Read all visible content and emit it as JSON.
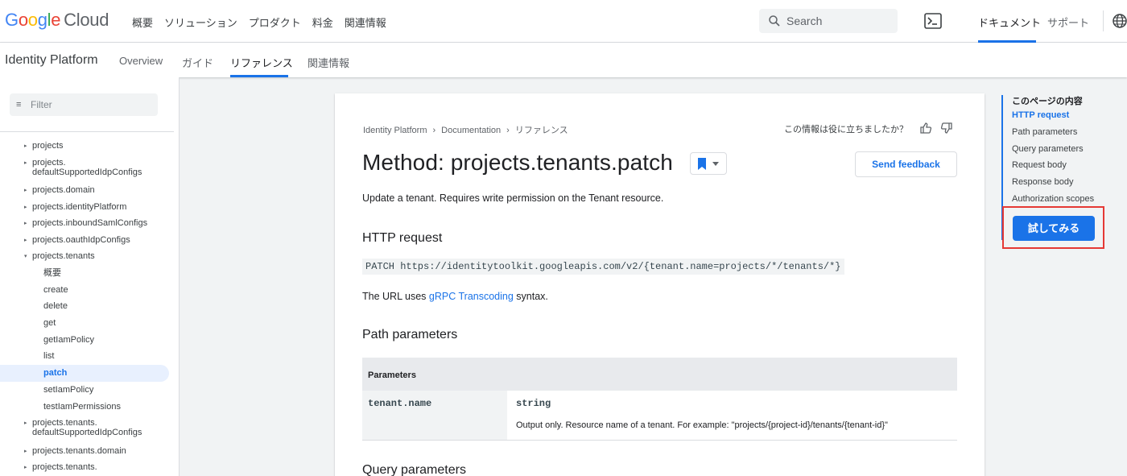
{
  "header": {
    "logo_google": [
      "G",
      "o",
      "o",
      "g",
      "l",
      "e"
    ],
    "logo_cloud": "Cloud",
    "nav": [
      "概要",
      "ソリューション",
      "プロダクト",
      "料金",
      "関連情報"
    ],
    "search_placeholder": "Search",
    "docs_label": "ドキュメント",
    "support_label": "サポート"
  },
  "subnav": {
    "product": "Identity Platform",
    "tabs": [
      "Overview",
      "ガイド",
      "リファレンス",
      "関連情報"
    ],
    "active_tab": "リファレンス"
  },
  "sidebar": {
    "filter_placeholder": "Filter",
    "items": [
      {
        "label": "projects",
        "arrow": "▸"
      },
      {
        "label": "projects.",
        "line2": "defaultSupportedIdpConfigs",
        "arrow": "▸"
      },
      {
        "label": "projects.domain",
        "arrow": "▸"
      },
      {
        "label": "projects.identityPlatform",
        "arrow": "▸"
      },
      {
        "label": "projects.inboundSamlConfigs",
        "arrow": "▸"
      },
      {
        "label": "projects.oauthIdpConfigs",
        "arrow": "▸"
      },
      {
        "label": "projects.tenants",
        "arrow": "▾"
      },
      {
        "label": "概要"
      },
      {
        "label": "create"
      },
      {
        "label": "delete"
      },
      {
        "label": "get"
      },
      {
        "label": "getIamPolicy"
      },
      {
        "label": "list"
      },
      {
        "label": "patch"
      },
      {
        "label": "setIamPolicy"
      },
      {
        "label": "testIamPermissions"
      },
      {
        "label": "projects.tenants.",
        "line2": "defaultSupportedIdpConfigs",
        "arrow": "▸"
      },
      {
        "label": "projects.tenants.domain",
        "arrow": "▸"
      },
      {
        "label": "projects.tenants.",
        "arrow": "▸"
      }
    ]
  },
  "content": {
    "breadcrumb": [
      "Identity Platform",
      "Documentation",
      "リファレンス"
    ],
    "breadcrumb_sep": "›",
    "helpful_text": "この情報は役に立ちましたか？",
    "title": "Method: projects.tenants.patch",
    "send_feedback": "Send feedback",
    "description": "Update a tenant. Requires write permission on the Tenant resource.",
    "http_heading": "HTTP request",
    "http_code": "PATCH https://identitytoolkit.googleapis.com/v2/{tenant.name=projects/*/tenants/*}",
    "url_prefix": "The URL uses ",
    "url_link": "gRPC Transcoding",
    "url_suffix": " syntax.",
    "path_heading": "Path parameters",
    "table_header": "Parameters",
    "param_name": "tenant.name",
    "param_type": "string",
    "param_desc": "Output only. Resource name of a tenant. For example: \"projects/{project-id}/tenants/{tenant-id}\"",
    "query_heading": "Query parameters"
  },
  "toc": {
    "title": "このページの内容",
    "items": [
      "HTTP request",
      "Path parameters",
      "Query parameters",
      "Request body",
      "Response body",
      "Authorization scopes"
    ],
    "active": "HTTP request",
    "try_button": "試してみる"
  },
  "colors": {
    "accent": "#1a73e8",
    "highlight_box": "#e53935"
  }
}
